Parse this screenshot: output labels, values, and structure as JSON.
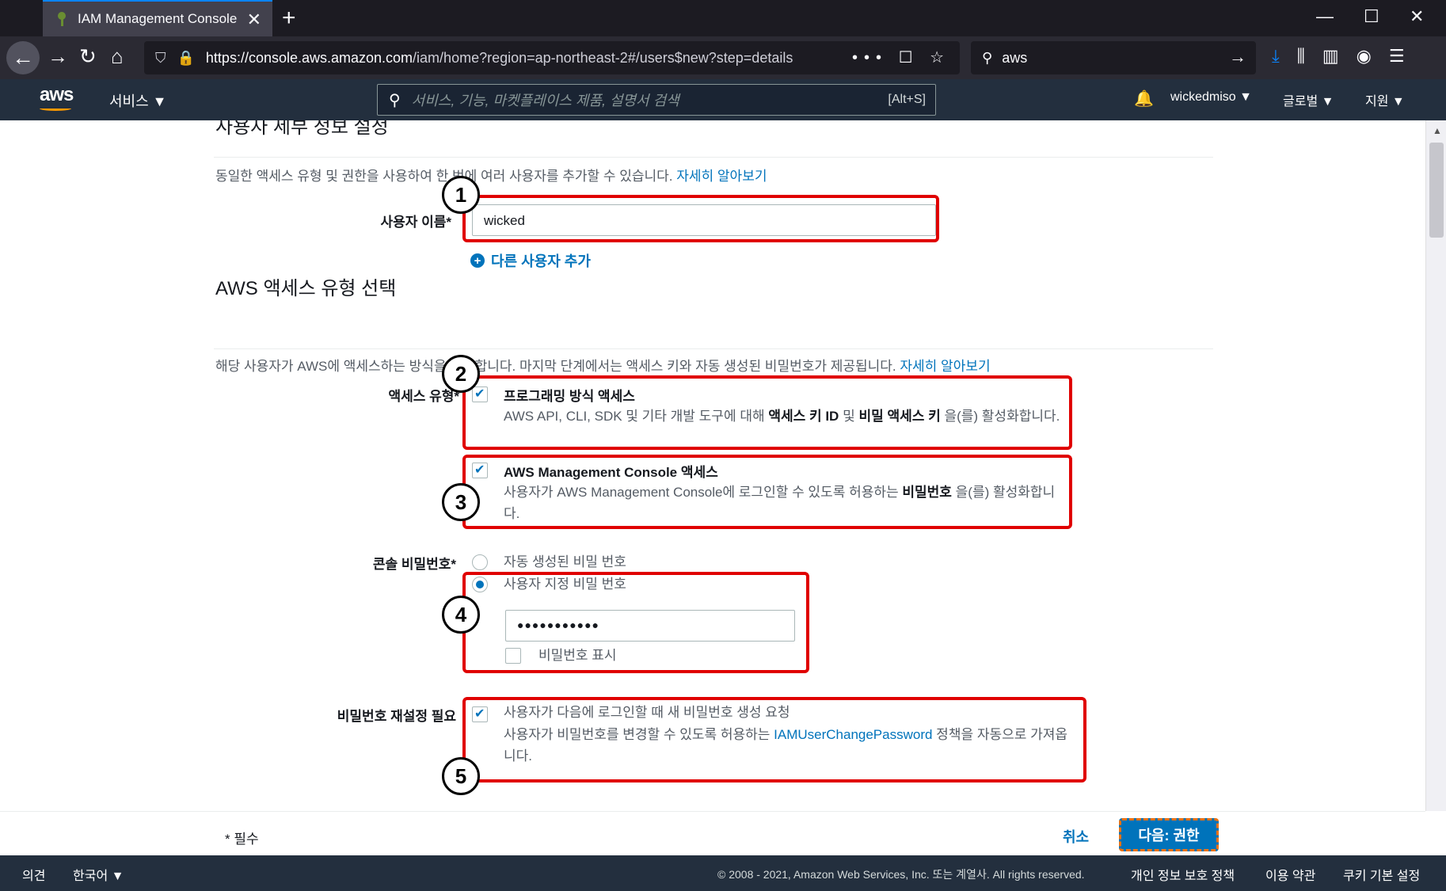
{
  "browser": {
    "tab_title": "IAM Management Console",
    "tab_close": "✕",
    "new_tab": "+",
    "window_controls": [
      "—",
      "☐",
      "✕"
    ],
    "url_host": "https://console.aws.amazon.com",
    "url_path": "/iam/home?region=ap-northeast-2#/users$new?step=details",
    "url_right_icons": "••• ☐ ☆",
    "search_value": "aws"
  },
  "awsnav": {
    "logo": "aws",
    "services": "서비스 ▼",
    "search_placeholder": "서비스, 기능, 마켓플레이스 제품, 설명서 검색",
    "search_shortcut": "[Alt+S]",
    "bell": "🔔",
    "user": "wickedmiso ▼",
    "region": "글로벌 ▼",
    "support": "지원 ▼"
  },
  "section1": {
    "title": "사용자 세부 정보 설정",
    "description": "동일한 액세스 유형 및 권한을 사용하여 한 번에 여러 사용자를 추가할 수 있습니다.",
    "learn_more": "자세히 알아보기",
    "username_label": "사용자 이름*",
    "username_value": "wicked",
    "add_user": "다른 사용자 추가"
  },
  "section2": {
    "title": "AWS 액세스 유형 선택",
    "description": "해당 사용자가 AWS에 액세스하는 방식을 선택합니다. 마지막 단계에서는 액세스 키와 자동 생성된 비밀번호가 제공됩니다.",
    "learn_more": "자세히 알아보기",
    "access_type_label": "액세스 유형*",
    "programmatic_title": "프로그래밍 방식 액세스",
    "programmatic_desc_1": "AWS API, CLI, SDK 및 기타 개발 도구에 대해 ",
    "programmatic_desc_b1": "액세스 키 ID",
    "programmatic_desc_2": " 및 ",
    "programmatic_desc_b2": "비밀 액세스 키",
    "programmatic_desc_3": " 을(를) 활성화합니다.",
    "console_title": "AWS Management Console 액세스",
    "console_desc_1": "사용자가 AWS Management Console에 로그인할 수 있도록 허용하는 ",
    "console_desc_b": "비밀번호",
    "console_desc_2": " 을(를) 활성화합니다.",
    "console_password_label": "콘솔 비밀번호*",
    "auto_password": "자동 생성된 비밀 번호",
    "custom_password": "사용자 지정 비밀 번호",
    "password_value": "●●●●●●●●●●●",
    "show_password": "비밀번호 표시",
    "reset_label": "비밀번호 재설정 필요",
    "reset_title": "사용자가 다음에 로그인할 때 새 비밀번호 생성 요청",
    "reset_desc_1": "사용자가 비밀번호를 변경할 수 있도록 허용하는 ",
    "reset_desc_link": "IAMUserChangePassword",
    "reset_desc_2": " 정책을 자동으로 가져옵니다."
  },
  "badges": [
    "1",
    "2",
    "3",
    "4",
    "5"
  ],
  "actions": {
    "required_note": "* 필수",
    "cancel": "취소",
    "next": "다음: 권한"
  },
  "footer": {
    "feedback": "의견",
    "language": "한국어 ▼",
    "copyright": "© 2008 - 2021, Amazon Web Services, Inc. 또는 계열사. All rights reserved.",
    "privacy": "개인 정보 보호 정책",
    "terms": "이용 약관",
    "cookies": "쿠키 기본 설정"
  }
}
